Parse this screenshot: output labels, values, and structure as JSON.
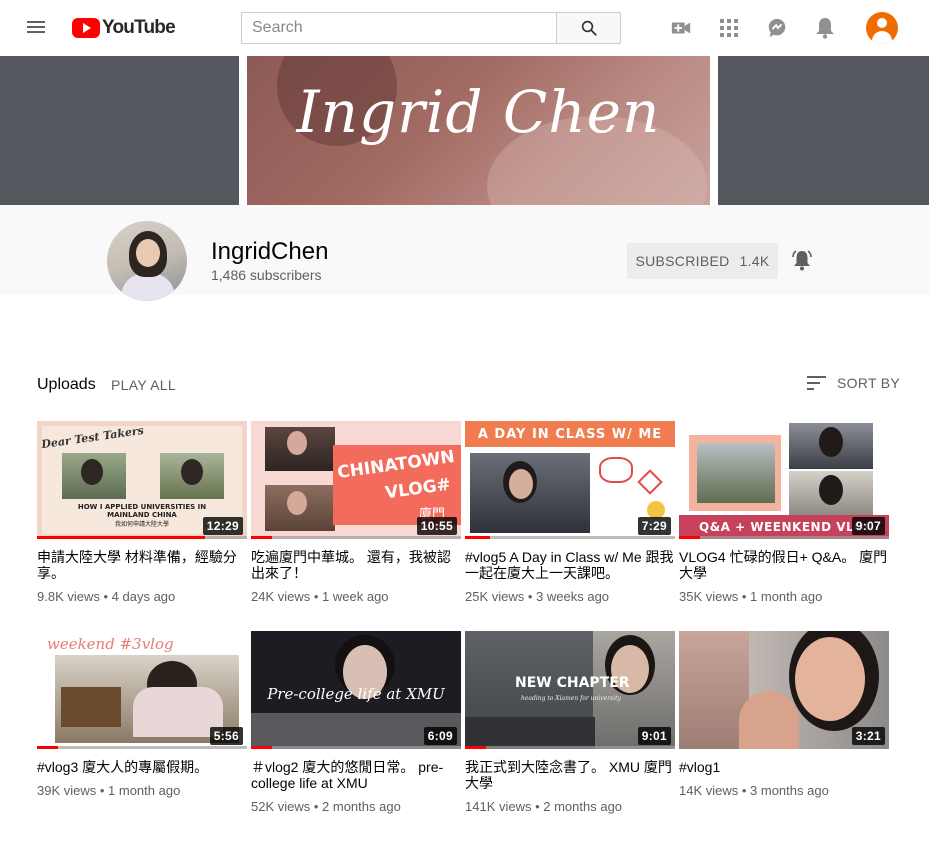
{
  "topbar": {
    "logo_text": "YouTube",
    "search_placeholder": "Search"
  },
  "banner": {
    "name": "Ingrid Chen"
  },
  "channel": {
    "name": "IngridChen",
    "subscribers": "1,486 subscribers",
    "subscribed_label": "SUBSCRIBED",
    "subscribed_count": "1.4K"
  },
  "section": {
    "title": "Uploads",
    "play_all": "PLAY ALL",
    "sort_by": "SORT BY"
  },
  "videos": [
    {
      "title": "申請大陸大學 材料準備，經驗分享。",
      "views": "9.8K views",
      "age": "4 days ago",
      "duration": "12:29",
      "watched": 0.8,
      "thumb_text": [
        "Dear Test Takers",
        "HOW I APPLIED UNIVERSITIES IN",
        "MAINLAND CHINA",
        "我如何申請大陸大學"
      ]
    },
    {
      "title": "吃遍廈門中華城。 還有，我被認出來了！",
      "views": "24K views",
      "age": "1 week ago",
      "duration": "10:55",
      "watched": 0.1,
      "thumb_text": [
        "CHINATOWN",
        "VLOG#",
        "廈門"
      ]
    },
    {
      "title": "#vlog5 A Day in Class w/ Me 跟我一起在廈大上一天課吧。",
      "views": "25K views",
      "age": "3 weeks ago",
      "duration": "7:29",
      "watched": 0.12,
      "thumb_text": [
        "A DAY IN CLASS W/ ME"
      ]
    },
    {
      "title": "VLOG4 忙碌的假日+ Q&A。 廈門大學",
      "views": "35K views",
      "age": "1 month ago",
      "duration": "9:07",
      "watched": 0.1,
      "thumb_text": [
        "Q&A + WEENKEND VLOG"
      ]
    },
    {
      "title": "#vlog3 廈大人的專屬假期。",
      "views": "39K views",
      "age": "1 month ago",
      "duration": "5:56",
      "watched": 0.1,
      "thumb_text": [
        "weekend #3vlog"
      ]
    },
    {
      "title": "＃vlog2 廈大的悠閒日常。 pre-college life at XMU",
      "views": "52K views",
      "age": "2 months ago",
      "duration": "6:09",
      "watched": 0.1,
      "thumb_text": [
        "Pre-college life at XMU"
      ]
    },
    {
      "title": "我正式到大陸念書了。 XMU 廈門大學",
      "views": "141K views",
      "age": "2 months ago",
      "duration": "9:01",
      "watched": 0.1,
      "thumb_text": [
        "NEW CHAPTER",
        "heading to Xiamen for university"
      ]
    },
    {
      "title": "#vlog1",
      "views": "14K views",
      "age": "3 months ago",
      "duration": "3:21",
      "watched": 0,
      "thumb_text": []
    }
  ],
  "colors": {
    "brand_red": "#ff0000",
    "progress_red": "#ff0000",
    "avatar_orange": "#ef6c00",
    "banner_bg": "#54575d"
  }
}
